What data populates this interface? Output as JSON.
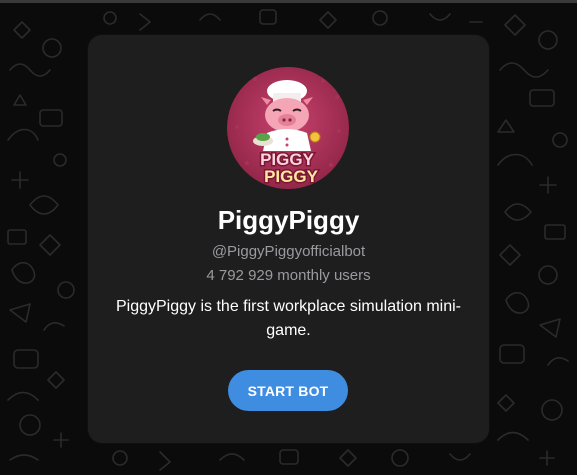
{
  "bot": {
    "name": "PiggyPiggy",
    "handle": "@PiggyPiggyofficialbot",
    "monthly_users": "4 792 929 monthly users",
    "description": "PiggyPiggy is the first workplace simulation mini-game.",
    "start_label": "START BOT",
    "avatar_icon": "piggy-chef-logo",
    "avatar_logo_text": "PIGGY PIGGY"
  },
  "colors": {
    "background": "#0b0b0b",
    "card": "#1e1e1f",
    "accent": "#3f8de0",
    "secondary_text": "#9b9b9f",
    "avatar_bg": "#b3355f"
  }
}
